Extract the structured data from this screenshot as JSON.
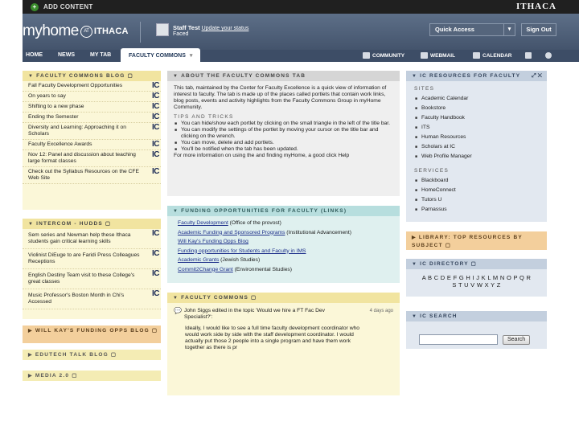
{
  "topbar": {
    "add_content": "ADD CONTENT",
    "ithaca": "ITHACA"
  },
  "brand": {
    "logo_main": "myhome",
    "logo_at": "AT",
    "logo_ithaca": "ITHACA",
    "user_name": "Staff Test",
    "user_status_link": "Update your status",
    "user_line2": "Faced",
    "quick_access": "Quick Access",
    "sign_out": "Sign Out"
  },
  "nav": {
    "tabs": [
      "HOME",
      "NEWS",
      "MY TAB",
      "FACULTY COMMONS"
    ],
    "right": [
      "COMMUNITY",
      "WEBMAIL",
      "CALENDAR"
    ]
  },
  "faculty_blog": {
    "title": "FACULTY COMMONS BLOG",
    "items": [
      "Fall Faculty Development Opportunities",
      "On years to say",
      "Shifting to a new phase",
      "Ending the Semester",
      "Diversity and Learning: Approaching it on Scholars",
      "Faculty Excellence Awards",
      "Nov 12: Panel and discussion about teaching large format classes",
      "Check out the Syllabus Resources on the CFE Web Site"
    ],
    "badge": "IC"
  },
  "intercom": {
    "title": "INTERCOM - HUDDS",
    "items": [
      "Sem series and Newman help these Ithaca students gain critical learning skills",
      "Violinist DiEuge to are Faridi Press Colleagues Receptions",
      "English Destiny Team visit to these College's great classes",
      "Music Professor's Boston Month in Chi's Accessed"
    ],
    "badge": "IC"
  },
  "wkfunding": {
    "title": "WILL KAY'S FUNDING OPPS BLOG"
  },
  "edutech": {
    "title": "EDUTECH TALK BLOG"
  },
  "media": {
    "title": "MEDIA 2.0"
  },
  "about": {
    "title": "ABOUT THE FACULTY COMMONS TAB",
    "intro": "This tab, maintained by the Center for Faculty Excellence is a quick view of information of interest to faculty. The tab is made up of the places called portlets that contain work links, blog posts, events and activity highlights from the Faculty Commons Group in myHome Community.",
    "tips_head": "TIPS AND TRICKS",
    "tips": [
      "You can hide/show each portlet by clicking on the small triangle in the left of the title bar.",
      "You can modify the settings of the portlet by moving your cursor on the title bar and clicking on the wrench.",
      "You can move, delete and add portlets.",
      "You'll be notified when the tab has been updated."
    ],
    "footer": "For more information on using the and finding myHome, a good click Help"
  },
  "funding": {
    "title": "FUNDING OPPORTUNITIES FOR FACULTY (LINKS)",
    "items": [
      {
        "link": "Faculty Development",
        "rest": " (Office of the provost)"
      },
      {
        "link": "Academic Funding and Sponsored Programs",
        "rest": " (Institutional Advancement)"
      },
      {
        "link": "Will Kay's Funding Opps Blog",
        "rest": ""
      },
      {
        "link": "Funding opportunities for Students and Faculty in IMS",
        "rest": ""
      },
      {
        "link": "Academic Grants",
        "rest": " (Jewish Studies)"
      },
      {
        "link": "Commit2Change Grant",
        "rest": " (Environmental Studies)"
      }
    ]
  },
  "fcomments": {
    "title": "FACULTY COMMONS",
    "comment_head": "John Siggs edited in the topic 'Would we hire a FT Fac Dev Specialist?':",
    "date": "4 days ago",
    "comment_body": "Ideally, I would like to see a full time faculty development coordinator who would work side by side with the staff development coordinator. I would actually put those 2 people into a single program and have them work together as there is pr"
  },
  "ic_resources": {
    "title": "IC RESOURCES FOR FACULTY",
    "sites_head": "SITES",
    "sites": [
      "Academic Calendar",
      "Bookstore",
      "Faculty Handbook",
      "ITS",
      "Human Resources",
      "Scholars at IC",
      "Web Profile Manager"
    ],
    "services_head": "SERVICES",
    "services": [
      "Blackboard",
      "HomeConnect",
      "Tutors U",
      "Parnassus"
    ]
  },
  "library": {
    "title": "LIBRARY: TOP RESOURCES BY SUBJECT"
  },
  "directory": {
    "title": "IC DIRECTORY",
    "letters1": "A B C D E F G H I J K L M N O P Q R",
    "letters2": "S T U V W X Y Z"
  },
  "search": {
    "title": "IC SEARCH",
    "button": "Search"
  }
}
